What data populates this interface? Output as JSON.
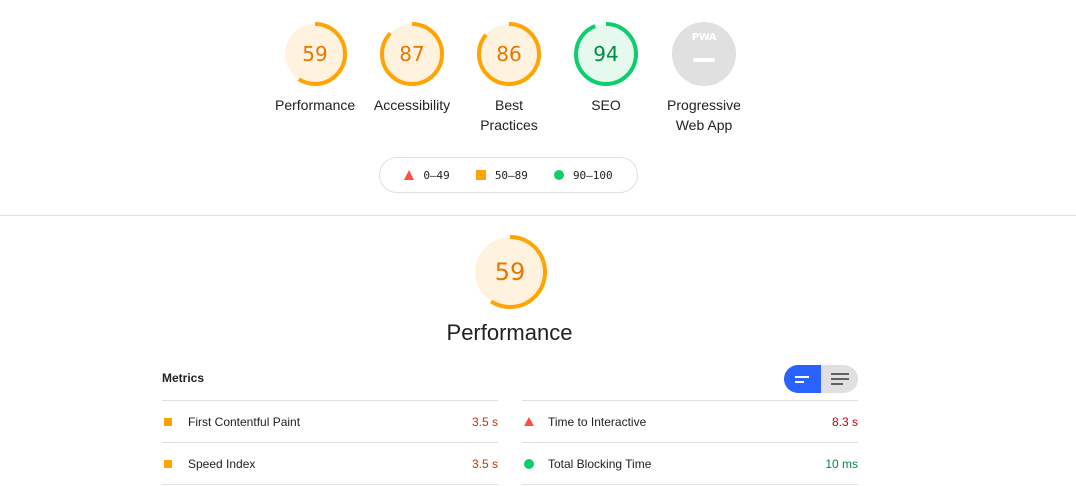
{
  "categories": [
    {
      "id": "performance",
      "score": "59",
      "label": "Performance",
      "status": "average",
      "fraction": 0.59
    },
    {
      "id": "accessibility",
      "score": "87",
      "label": "Accessibility",
      "status": "average",
      "fraction": 0.87
    },
    {
      "id": "best-practices",
      "score": "86",
      "label": "Best Practices",
      "status": "average",
      "fraction": 0.86
    },
    {
      "id": "seo",
      "score": "94",
      "label": "SEO",
      "status": "pass",
      "fraction": 0.94
    },
    {
      "id": "pwa",
      "score": "",
      "label": "Progressive Web App",
      "status": "na",
      "badge": "PWA"
    }
  ],
  "legend": {
    "fail": "0–49",
    "average": "50–89",
    "pass": "90–100"
  },
  "performance_section": {
    "score": "59",
    "fraction": 0.59,
    "title": "Performance"
  },
  "metrics": {
    "title": "Metrics",
    "left": [
      {
        "name": "First Contentful Paint",
        "value": "3.5 s",
        "status": "average"
      },
      {
        "name": "Speed Index",
        "value": "3.5 s",
        "status": "average"
      }
    ],
    "right": [
      {
        "name": "Time to Interactive",
        "value": "8.3 s",
        "status": "fail"
      },
      {
        "name": "Total Blocking Time",
        "value": "10 ms",
        "status": "pass"
      }
    ]
  },
  "colors": {
    "average": "#ffa400",
    "average_bg": "#fff3e0",
    "pass": "#0cce6b",
    "pass_bg": "#e6f9ef",
    "fail": "#ff4e42",
    "na": "#e0e0e0",
    "toggle_on": "#2962ff"
  },
  "icons": [
    "triangle-fail-icon",
    "square-average-icon",
    "circle-pass-icon",
    "pwa-badge-icon",
    "view-collapsed-icon",
    "view-expanded-icon"
  ]
}
